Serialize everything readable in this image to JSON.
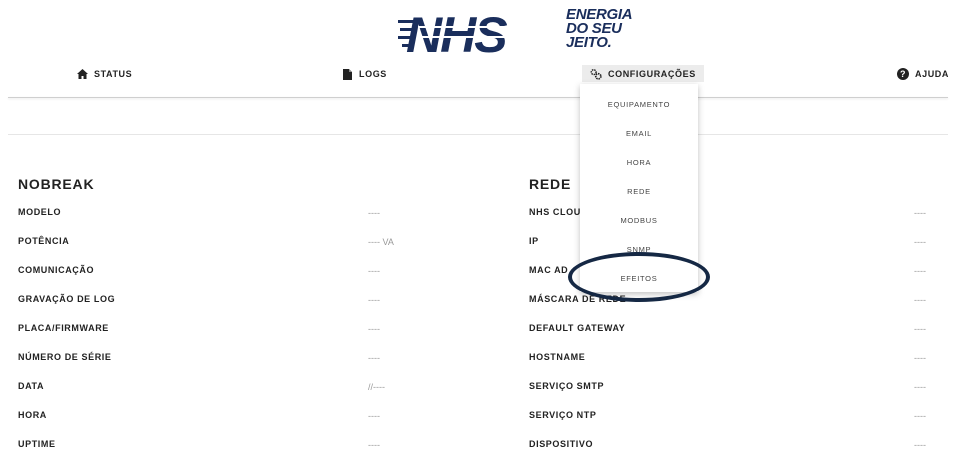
{
  "brand": {
    "logo_text": "NHS",
    "slogan_lines": [
      "ENERGIA",
      "DO SEU",
      "JEITO."
    ]
  },
  "nav": {
    "status": "STATUS",
    "logs": "LOGS",
    "config": "CONFIGURAÇÕES",
    "help": "AJUDA"
  },
  "dropdown": {
    "items": [
      "EQUIPAMENTO",
      "EMAIL",
      "HORA",
      "REDE",
      "MODBUS",
      "SNMP",
      "EFEITOS"
    ]
  },
  "nobreak": {
    "title": "NOBREAK",
    "rows": [
      {
        "label": "MODELO",
        "value": "----"
      },
      {
        "label": "POTÊNCIA",
        "value": "---- VA"
      },
      {
        "label": "COMUNICAÇÃO",
        "value": "----"
      },
      {
        "label": "GRAVAÇÃO DE LOG",
        "value": "----"
      },
      {
        "label": "PLACA/FIRMWARE",
        "value": "----"
      },
      {
        "label": "NÚMERO DE SÉRIE",
        "value": "----"
      },
      {
        "label": "DATA",
        "value": "//----"
      },
      {
        "label": "HORA",
        "value": "----"
      },
      {
        "label": "UPTIME",
        "value": "----"
      }
    ]
  },
  "rede": {
    "title": "REDE",
    "rows": [
      {
        "label": "NHS CLOU",
        "value": "----"
      },
      {
        "label": "IP",
        "value": "----"
      },
      {
        "label": "MAC AD",
        "value": "----"
      },
      {
        "label": "MÁSCARA DE REDE",
        "value": "----"
      },
      {
        "label": "DEFAULT GATEWAY",
        "value": "----"
      },
      {
        "label": "HOSTNAME",
        "value": "----"
      },
      {
        "label": "SERVIÇO SMTP",
        "value": "----"
      },
      {
        "label": "SERVIÇO NTP",
        "value": "----"
      },
      {
        "label": "DISPOSITIVO",
        "value": "----"
      }
    ]
  },
  "colors": {
    "brand_blue": "#1a2e5c",
    "annotation_circle": "#152844"
  }
}
